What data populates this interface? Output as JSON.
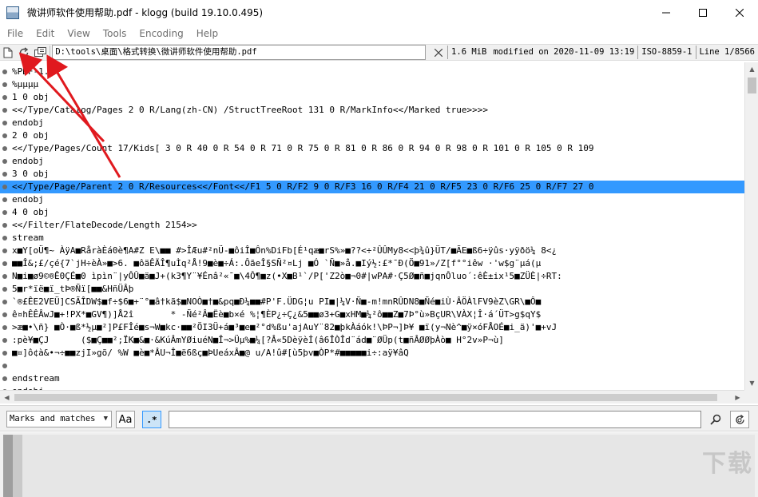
{
  "window": {
    "title": "微讲师软件使用帮助.pdf - klogg (build 19.10.0.495)",
    "controls": [
      "minimize-icon",
      "maximize-icon",
      "close-icon"
    ]
  },
  "menu": [
    "File",
    "Edit",
    "View",
    "Tools",
    "Encoding",
    "Help"
  ],
  "toolbar": {
    "buttons": [
      "open-file-icon",
      "reload-icon",
      "follow-icon"
    ],
    "path": "D:\\tools\\桌面\\格式转换\\微讲师软件使用帮助.pdf",
    "size": "1.6 MiB",
    "modified": "modified on 2020-11-09 13:19",
    "encoding": "ISO-8859-1",
    "line": "Line 1/8566"
  },
  "editor": {
    "selected_index": 9,
    "lines": [
      "%PDF-1.5",
      "%µµµµ",
      "1 0 obj",
      "<</Type/Catalog/Pages 2 0 R/Lang(zh-CN) /StructTreeRoot 131 0 R/MarkInfo<</Marked true>>>>",
      "endobj",
      "2 0 obj",
      "<</Type/Pages/Count 17/Kids[ 3 0 R 40 0 R 54 0 R 71 0 R 75 0 R 81 0 R 86 0 R 94 0 R 98 0 R 101 0 R 105 0 R 109",
      "endobj",
      "3 0 obj",
      "<</Type/Page/Parent 2 0 R/Resources<</Font<</F1 5 0 R/F2 9 0 R/F3 16 0 R/F4 21 0 R/F5 23 0 R/F6 25 0 R/F7 27 0",
      "endobj",
      "4 0 obj",
      "<</Filter/FlateDecode/Length 2154>>",
      "stream",
      "x■Y[oÜ¶~ ÀÿA■RåràÈá0è¶A#Z E\\■■ #>ÎÆu#²nÜ-■ôiÎ■Ôn%DiFb[É¹qæ■rS%»■??<÷²ÛÛMy8<<þ¾û}ÜT/■ÃE■ß6÷ÿûs·yÿðö¼ 8<¿",
      "■■Î&;£/çé{7`jH÷èÀ»■>6. ■ôäÊÄÎ¶uÌq²Å!9■è■÷Á:.ÔãeÎ§SÑ²¤Lj ■Ó `Ñ■»å.■Iý½:£*¯Ð(Ö■91»/Z[f°°iêw ·'w$g¨µá(µ",
      "N■i■ø9©®Ê0ÇÉ■0 ìpìn¨|yÔÛ■ä■J+(k3¶Y¨¥Énâ²«¯■\\4Ô¶■z(•X■B¹`/P['Z2ò■¬0#|wPA#·Ç5Ø■ñ■jqnÔluo´:êÈ±ix¹5■ZÜÈ|÷RT:",
      "5■r*ïë■ï_tÞ®Ñï[■■&HñÜÂþ",
      "`®£ÊE2VEÜ]CSÃÎDW$■f÷$6■+¨°■â†kã$■NOÒ■†■&pq■Ð¼■■#P'F.ÜDG¦u PI■|¼V·Ñ■-m!mnRÛDN8■Ñé■iÙ·ÂÖÀlFV9èZ\\GR\\■Ô■",
      "ê¤hÊÊÂwJ■+!PX*■GV¶)]Å2î       * -Ñé²Â■Ëè■b×é %¦¶ÈP¿÷Ç¿&5■■ø3+G■xHM■¼²ô■■Z■7Þ°ù»BçUR\\VÀX¦Î·á´ÜT>g$qY$",
      ">æ■•\\ñ} ■Ò·■ß*½µ■²]P£FÎé■s¬W■kc·■■²ÖI3Ü+á■³■e■²°d%ßu'ajAuY¨82■þkÀáók!\\ÞP¬]Þ¥ ■ï(y¬Nè^■ÿ×óFÅOÉ■i_ä)'■+vJ",
      ":pè¥■ÇJ      ($■Ç■■²;ÏK■&■·&KúÂmYØiuéN■Î¬>Üµ%■¼[?Â«5Dèÿèİ(â6ÎÒÎd¨ád■¨ØÜp(t■ñÂØØþÀò■ H°2v»P¬ù]",
      "■¤]ô¢à&•¬÷■■zjI»gõ/ %W ■è■*ÂU¬Î■ë6ßç■ÞUeáxÂ■@ u/A!û#[ù5þv■ÒP*#■■■■■i÷:aÿ¥âQ",
      "",
      "endstream",
      "endobj"
    ]
  },
  "search": {
    "mode": "Marks and matches",
    "case_label": "Aa",
    "regex_label": ".*",
    "query": "",
    "buttons": [
      "search-icon",
      "auto-refresh-icon"
    ]
  },
  "watermark": "下载"
}
